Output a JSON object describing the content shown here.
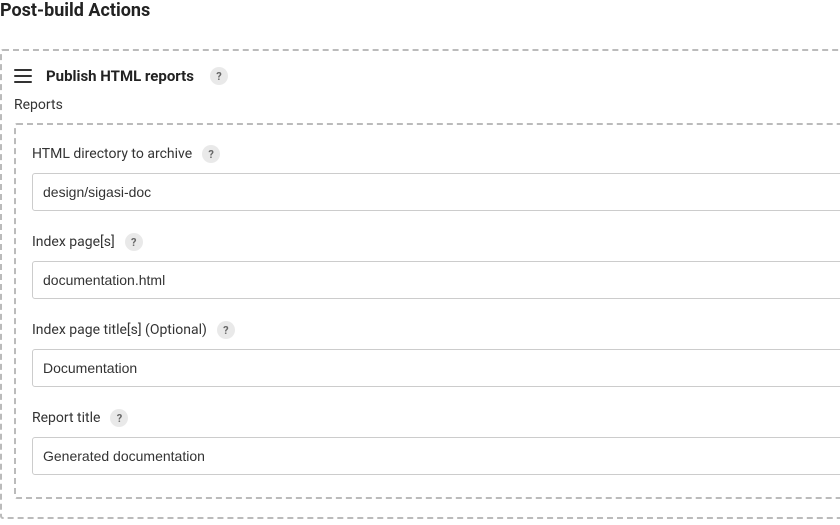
{
  "section": {
    "title": "Post-build Actions"
  },
  "block": {
    "title": "Publish HTML reports",
    "help": "?"
  },
  "reports_label": "Reports",
  "fields": {
    "html_dir": {
      "label": "HTML directory to archive",
      "help": "?",
      "value": "design/sigasi-doc"
    },
    "index_pages": {
      "label": "Index page[s]",
      "help": "?",
      "value": "documentation.html"
    },
    "index_titles": {
      "label": "Index page title[s] (Optional)",
      "help": "?",
      "value": "Documentation"
    },
    "report_title": {
      "label": "Report title",
      "help": "?",
      "value": "Generated documentation"
    }
  }
}
